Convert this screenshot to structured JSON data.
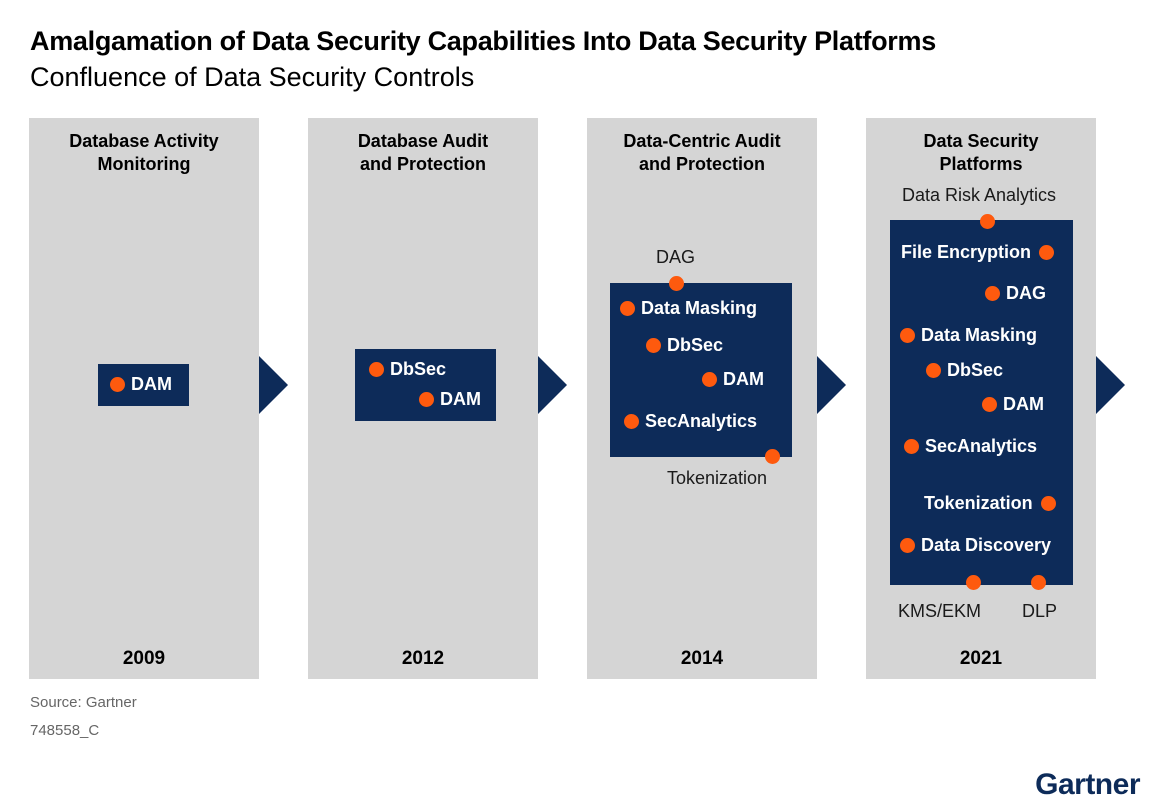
{
  "title": "Amalgamation of Data Security Capabilities Into Data Security Platforms",
  "subtitle": "Confluence of Data Security Controls",
  "stages": [
    {
      "title": "Database Activity\nMonitoring",
      "year": "2009",
      "items": [
        "DAM"
      ]
    },
    {
      "title": "Database Audit\nand Protection",
      "year": "2012",
      "items": [
        "DbSec",
        "DAM"
      ]
    },
    {
      "title": "Data-Centric Audit\nand Protection",
      "year": "2014",
      "items": [
        "Data Masking",
        "DbSec",
        "DAM",
        "SecAnalytics"
      ],
      "outer": [
        "DAG",
        "Tokenization"
      ]
    },
    {
      "title": "Data Security\nPlatforms",
      "year": "2021",
      "items": [
        "File Encryption",
        "DAG",
        "Data Masking",
        "DbSec",
        "DAM",
        "SecAnalytics",
        "Tokenization",
        "Data Discovery"
      ],
      "outer": [
        "Data Risk Analytics",
        "KMS/EKM",
        "DLP"
      ]
    }
  ],
  "source": "Source: Gartner",
  "code": "748558_C",
  "logo": "Gartner",
  "colors": {
    "box": "#0d2b59",
    "dot": "#fe5a0e",
    "panel": "#d5d5d5",
    "text_secondary": "#666666"
  }
}
